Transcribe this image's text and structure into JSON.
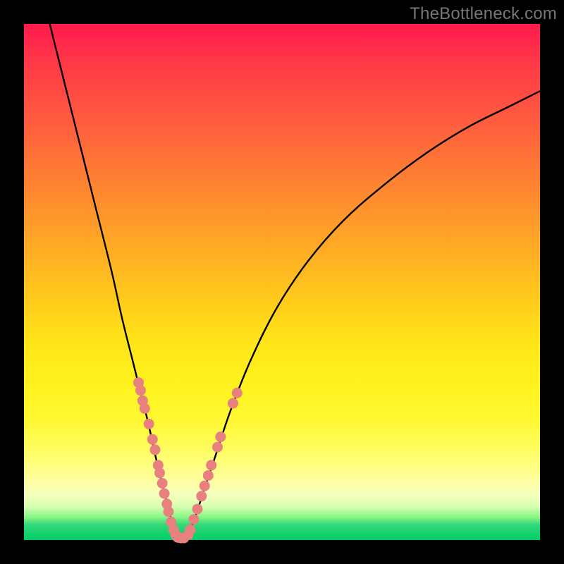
{
  "watermark": "TheBottleneck.com",
  "chart_data": {
    "type": "line",
    "title": "",
    "xlabel": "",
    "ylabel": "",
    "x_range": [
      0,
      100
    ],
    "y_range": [
      0,
      100
    ],
    "series": [
      {
        "name": "left-curve",
        "x": [
          5,
          8,
          11,
          14,
          17,
          19,
          21,
          22.5,
          24,
          25,
          26,
          27,
          28,
          28.8,
          29.5
        ],
        "y": [
          100,
          88,
          76,
          64,
          52,
          43,
          35,
          29,
          23,
          18.5,
          14,
          10,
          6,
          3,
          0.5
        ]
      },
      {
        "name": "right-curve",
        "x": [
          31.5,
          33,
          35,
          37,
          40,
          44,
          49,
          55,
          62,
          70,
          78,
          86,
          94,
          100
        ],
        "y": [
          0.5,
          4,
          10,
          16,
          25,
          35,
          45,
          54,
          62,
          69,
          75,
          80,
          84,
          87
        ]
      }
    ],
    "markers_left": [
      {
        "x": 22.2,
        "y": 30.5
      },
      {
        "x": 22.6,
        "y": 29
      },
      {
        "x": 23.0,
        "y": 27
      },
      {
        "x": 23.4,
        "y": 25.5
      },
      {
        "x": 24.2,
        "y": 22.5
      },
      {
        "x": 24.9,
        "y": 19.5
      },
      {
        "x": 25.4,
        "y": 17.5
      },
      {
        "x": 26.0,
        "y": 14.5
      },
      {
        "x": 26.3,
        "y": 13
      },
      {
        "x": 26.8,
        "y": 11
      },
      {
        "x": 27.2,
        "y": 9
      },
      {
        "x": 27.7,
        "y": 7
      },
      {
        "x": 28.0,
        "y": 5.5
      },
      {
        "x": 28.5,
        "y": 3.5
      },
      {
        "x": 29.0,
        "y": 2
      },
      {
        "x": 29.4,
        "y": 1
      }
    ],
    "markers_right": [
      {
        "x": 31.8,
        "y": 1
      },
      {
        "x": 32.2,
        "y": 2
      },
      {
        "x": 32.9,
        "y": 4
      },
      {
        "x": 33.6,
        "y": 6
      },
      {
        "x": 34.4,
        "y": 8.5
      },
      {
        "x": 35.0,
        "y": 10.5
      },
      {
        "x": 35.7,
        "y": 12.5
      },
      {
        "x": 36.3,
        "y": 14.5
      },
      {
        "x": 37.5,
        "y": 18
      },
      {
        "x": 38.1,
        "y": 20
      },
      {
        "x": 40.5,
        "y": 26.5
      },
      {
        "x": 41.3,
        "y": 28.5
      }
    ],
    "markers_bottom": [
      {
        "x": 29.8,
        "y": 0.5
      },
      {
        "x": 30.4,
        "y": 0.4
      },
      {
        "x": 31.0,
        "y": 0.4
      }
    ],
    "marker_radius": 7.5,
    "colors": {
      "curve": "#000000",
      "marker": "#e98080",
      "gradient_top": "#ff1a4d",
      "gradient_mid": "#ffe619",
      "gradient_bottom": "#00cc66"
    }
  }
}
